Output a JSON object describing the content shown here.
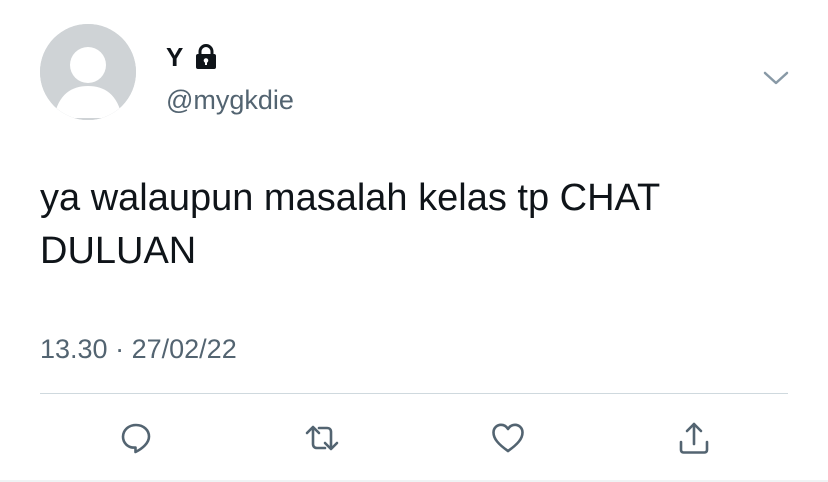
{
  "tweet": {
    "author": {
      "display_name": "Y",
      "handle": "@mygkdie",
      "protected_icon": "lock-icon",
      "avatar_icon": "default-avatar-icon"
    },
    "text": "ya walaupun masalah kelas tp CHAT DULUAN",
    "time": "13.30",
    "separator": "·",
    "date": "27/02/22",
    "menu_icon": "chevron-down-icon"
  },
  "actions": [
    {
      "name": "reply",
      "icon": "reply-icon"
    },
    {
      "name": "retweet",
      "icon": "retweet-icon"
    },
    {
      "name": "like",
      "icon": "heart-icon"
    },
    {
      "name": "share",
      "icon": "share-icon"
    }
  ],
  "colors": {
    "text_primary": "#0f1419",
    "text_secondary": "#536471",
    "icon": "#536471",
    "avatar_bg": "#cfd3d6",
    "divider": "#cfd9de"
  }
}
